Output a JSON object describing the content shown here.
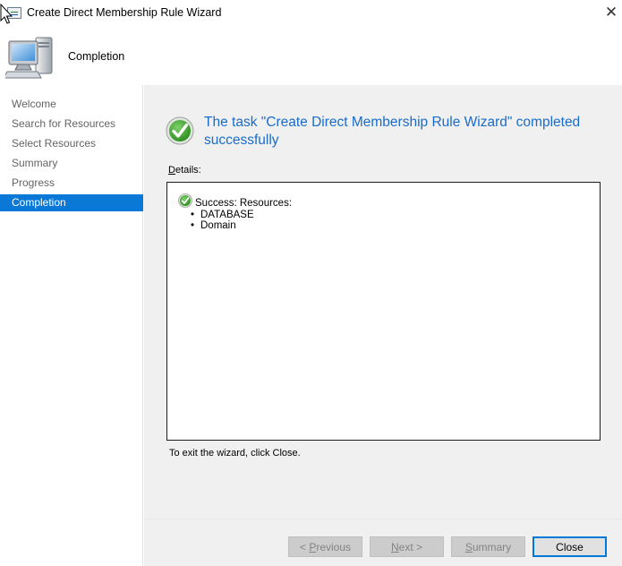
{
  "window": {
    "title": "Create Direct Membership Rule Wizard",
    "close_glyph": "✕"
  },
  "header": {
    "page_title": "Completion",
    "icon": "computer-icon"
  },
  "sidebar": {
    "items": [
      {
        "label": "Welcome",
        "active": false
      },
      {
        "label": "Search for Resources",
        "active": false
      },
      {
        "label": "Select Resources",
        "active": false
      },
      {
        "label": "Summary",
        "active": false
      },
      {
        "label": "Progress",
        "active": false
      },
      {
        "label": "Completion",
        "active": true
      }
    ]
  },
  "main": {
    "task_message": "The task \"Create Direct Membership Rule Wizard\" completed successfully",
    "details_label_accel": "D",
    "details_label_rest": "etails:",
    "details": {
      "success_text": "Success: Resources:",
      "resources": [
        "DATABASE",
        "Domain"
      ]
    },
    "exit_text": "To exit the wizard, click Close."
  },
  "buttons": {
    "previous_pre": "< ",
    "previous_accel": "P",
    "previous_rest": "revious",
    "next_accel": "N",
    "next_rest": "ext >",
    "summary_accel": "S",
    "summary_rest": "ummary",
    "close_label": "Close"
  },
  "colors": {
    "accent": "#0a78d7",
    "title_blue": "#1a6cc8",
    "success_green": "#3a9a2a"
  }
}
